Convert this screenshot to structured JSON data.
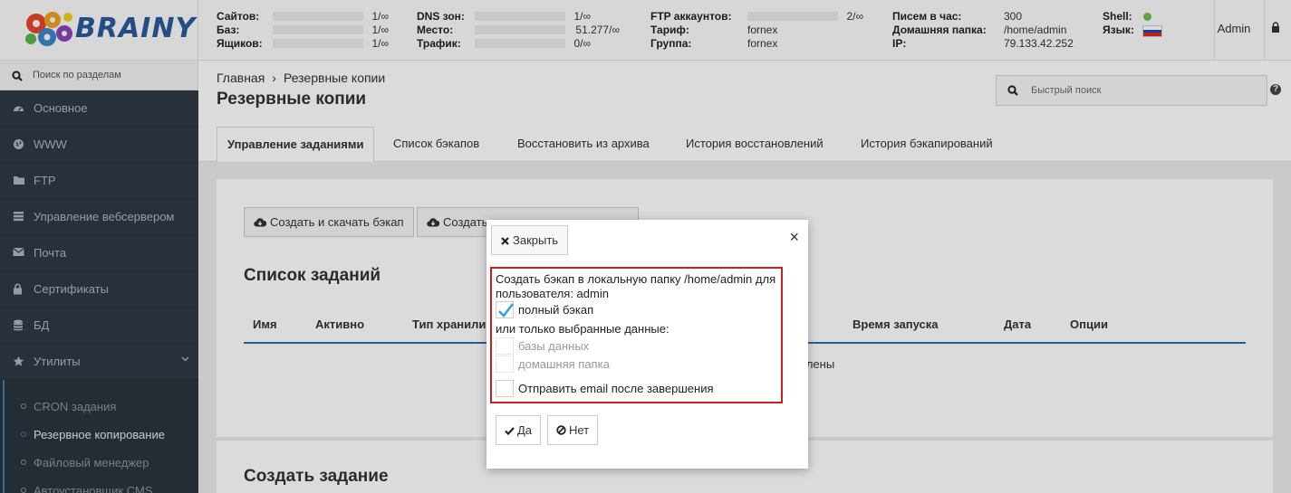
{
  "logo": {
    "text": "BRAINY"
  },
  "stats": {
    "col1": [
      {
        "label": "Сайтов:",
        "value": "1/∞"
      },
      {
        "label": "Баз:",
        "value": "1/∞"
      },
      {
        "label": "Ящиков:",
        "value": "1/∞"
      }
    ],
    "col2": [
      {
        "label": "DNS зон:",
        "value": "1/∞"
      },
      {
        "label": "Место:",
        "value": "51.277/∞"
      },
      {
        "label": "Трафик:",
        "value": "0/∞"
      }
    ],
    "col3": [
      {
        "label": "FTP аккаунтов:",
        "value": "2/∞"
      },
      {
        "label": "Тариф:",
        "value": "fornex"
      },
      {
        "label": "Группа:",
        "value": "fornex"
      }
    ],
    "col4": [
      {
        "label": "Писем в час:",
        "value": "300"
      },
      {
        "label": "Домашняя папка:",
        "value": "/home/admin"
      },
      {
        "label": "IP:",
        "value": "79.133.42.252"
      }
    ],
    "col5": [
      {
        "label": "Shell:"
      },
      {
        "label": "Язык:"
      }
    ]
  },
  "user": {
    "name": "Admin"
  },
  "sidebar": {
    "search_placeholder": "Поиск по разделам",
    "items": [
      {
        "label": "Основное",
        "icon": "dashboard-icon"
      },
      {
        "label": "WWW",
        "icon": "globe-icon"
      },
      {
        "label": "FTP",
        "icon": "folder-icon"
      },
      {
        "label": "Управление вебсервером",
        "icon": "server-icon"
      },
      {
        "label": "Почта",
        "icon": "mail-icon"
      },
      {
        "label": "Сертификаты",
        "icon": "lock-icon"
      },
      {
        "label": "БД",
        "icon": "database-icon"
      },
      {
        "label": "Утилиты",
        "icon": "star-icon"
      }
    ],
    "subitems": [
      {
        "label": "CRON задания"
      },
      {
        "label": "Резервное копирование"
      },
      {
        "label": "Файловый менеджер"
      },
      {
        "label": "Автоустановщик CMS"
      }
    ]
  },
  "breadcrumb": {
    "home": "Главная",
    "sep": "›",
    "current": "Резервные копии"
  },
  "page_title": "Резервные копии",
  "quick_search": {
    "placeholder": "Быстрый поиск"
  },
  "help_label": "?",
  "tabs": [
    {
      "label": "Управление заданиями",
      "active": true
    },
    {
      "label": "Список бэкапов"
    },
    {
      "label": "Восстановить из архива"
    },
    {
      "label": "История восстановлений"
    },
    {
      "label": "История бэкапирований"
    }
  ],
  "actions": {
    "create_download": "Создать и скачать бэкап",
    "create_partial": "Создать"
  },
  "tasks": {
    "title": "Список заданий",
    "columns": [
      "Имя",
      "Активно",
      "Тип хранили",
      "Время запуска",
      "Дата",
      "Опции"
    ],
    "empty_partial": "авлены"
  },
  "create_task": {
    "title": "Создать задание"
  },
  "modal": {
    "close_label": "Закрыть",
    "x": "×",
    "description": "Создать бэкап в локальную папку /home/admin для пользователя: admin",
    "full_backup": {
      "label": "полный бэкап",
      "checked": true
    },
    "or_text": "или только выбранные данные:",
    "databases": {
      "label": "базы данных",
      "checked": false,
      "disabled": true
    },
    "home_folder": {
      "label": "домашняя папка",
      "checked": false,
      "disabled": true
    },
    "send_email": {
      "label": "Отправить email после завершения",
      "checked": false
    },
    "yes": "Да",
    "no": "Нет"
  },
  "colors": {
    "accent": "#2f6ea3",
    "sidebar": "#2f3a44",
    "highlight": "#cc1f1f",
    "check": "#2b9fd8"
  }
}
